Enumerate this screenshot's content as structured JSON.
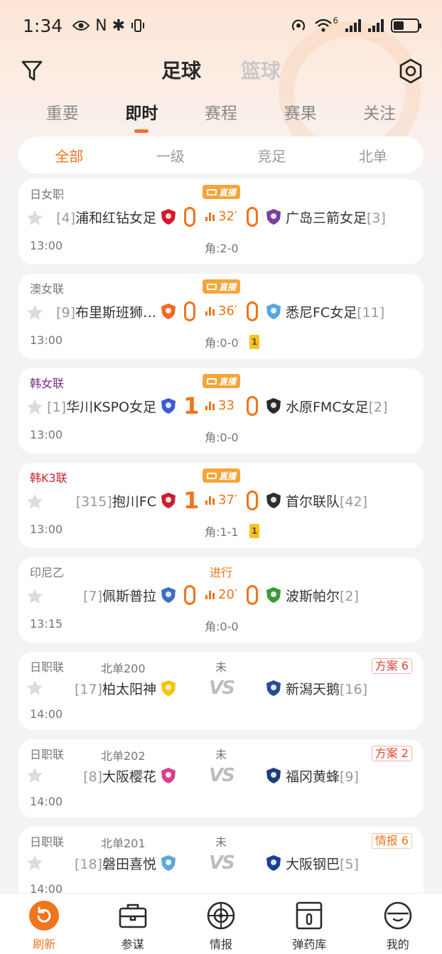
{
  "status_bar": {
    "time": "1:34",
    "glyphs": "N ✱",
    "network": "6"
  },
  "header": {
    "sport_tabs": [
      {
        "label": "足球",
        "active": true
      },
      {
        "label": "篮球",
        "active": false
      }
    ]
  },
  "sub_tabs": [
    {
      "label": "重要",
      "active": false
    },
    {
      "label": "即时",
      "active": true
    },
    {
      "label": "赛程",
      "active": false
    },
    {
      "label": "赛果",
      "active": false
    },
    {
      "label": "关注",
      "active": false
    }
  ],
  "level_filter": [
    {
      "label": "全部",
      "active": true
    },
    {
      "label": "一级",
      "active": false
    },
    {
      "label": "竞足",
      "active": false
    },
    {
      "label": "北单",
      "active": false
    }
  ],
  "live_badge_label": "直播",
  "matches": [
    {
      "league": "日女职",
      "league_color": "#777777",
      "kickoff": "13:00",
      "status": "live",
      "home_rank": "[4]",
      "home": "浦和红钻女足",
      "home_score": "0",
      "away_score": "0",
      "away": "广岛三箭女足",
      "away_rank": "[3]",
      "minute": "32′",
      "corners": "角:2-0",
      "yellow": "",
      "home_logo_color": "#d6182a",
      "away_logo_color": "#7a3f9c"
    },
    {
      "league": "澳女联",
      "league_color": "#777777",
      "kickoff": "13:00",
      "status": "live",
      "home_rank": "[9]",
      "home": "布里斯班狮…",
      "home_score": "0",
      "away_score": "0",
      "away": "悉尼FC女足",
      "away_rank": "[11]",
      "minute": "36′",
      "corners": "角:0-0",
      "yellow": "1",
      "home_logo_color": "#f26a21",
      "away_logo_color": "#55a7de"
    },
    {
      "league": "韩女联",
      "league_color": "#7b2d8e",
      "kickoff": "13:00",
      "status": "live",
      "home_rank": "[1]",
      "home": "华川KSPO女足",
      "home_score": "1",
      "away_score": "0",
      "away": "水原FMC女足",
      "away_rank": "[2]",
      "minute": "33",
      "corners": "角:0-0",
      "yellow": "",
      "home_logo_color": "#3d5bd9",
      "away_logo_color": "#2a2a2a"
    },
    {
      "league": "韩K3联",
      "league_color": "#c1272d",
      "kickoff": "13:00",
      "status": "live",
      "home_rank": "[315]",
      "home": "抱川FC",
      "home_score": "1",
      "away_score": "0",
      "away": "首尔联队",
      "away_rank": "[42]",
      "minute": "37′",
      "corners": "角:1-1",
      "yellow": "1",
      "home_logo_color": "#c8202c",
      "away_logo_color": "#2d2d2d"
    },
    {
      "league": "印尼乙",
      "league_color": "#777777",
      "kickoff": "13:15",
      "status": "in_progress",
      "status_label": "进行",
      "home_rank": "[7]",
      "home": "佩斯普拉",
      "home_score": "0",
      "away_score": "0",
      "away": "波斯帕尔",
      "away_rank": "[2]",
      "minute": "20′",
      "corners": "角:0-0",
      "yellow": "",
      "home_logo_color": "#3b6fc2",
      "away_logo_color": "#3a9b3a"
    },
    {
      "league": "日职联",
      "league_color": "#777777",
      "code": "北单200",
      "kickoff": "14:00",
      "status": "upcoming",
      "status_label": "未",
      "home_rank": "[17]",
      "home": "柏太阳神",
      "away": "新潟天鹅",
      "away_rank": "[16]",
      "vs_label": "VS",
      "tag": "方案 6",
      "tag_color": "#e0412f",
      "home_logo_color": "#f5c400",
      "away_logo_color": "#2a4a9a"
    },
    {
      "league": "日职联",
      "league_color": "#777777",
      "code": "北单202",
      "kickoff": "14:00",
      "status": "upcoming",
      "status_label": "未",
      "home_rank": "[8]",
      "home": "大阪樱花",
      "away": "福冈黄蜂",
      "away_rank": "[9]",
      "vs_label": "VS",
      "tag": "方案 2",
      "tag_color": "#e0412f",
      "home_logo_color": "#d9418c",
      "away_logo_color": "#1b3f78"
    },
    {
      "league": "日职联",
      "league_color": "#777777",
      "code": "北单201",
      "kickoff": "14:00",
      "status": "upcoming",
      "status_label": "未",
      "home_rank": "[18]",
      "home": "磐田喜悦",
      "away": "大阪钢巴",
      "away_rank": "[5]",
      "vs_label": "VS",
      "tag": "情报 6",
      "tag_color": "#f0741b",
      "home_logo_color": "#5fa7d8",
      "away_logo_color": "#1c3e9a"
    }
  ],
  "bottom_nav": [
    {
      "label": "刷新",
      "icon": "refresh-icon",
      "active": true
    },
    {
      "label": "参谋",
      "icon": "briefcase-icon",
      "active": false
    },
    {
      "label": "情报",
      "icon": "radar-icon",
      "active": false
    },
    {
      "label": "弹药库",
      "icon": "ammo-box-icon",
      "active": false
    },
    {
      "label": "我的",
      "icon": "profile-icon",
      "active": false
    }
  ],
  "colors": {
    "accent": "#f0741b",
    "live_badge": "#f5a53a",
    "yellow_card": "#f7c325"
  }
}
